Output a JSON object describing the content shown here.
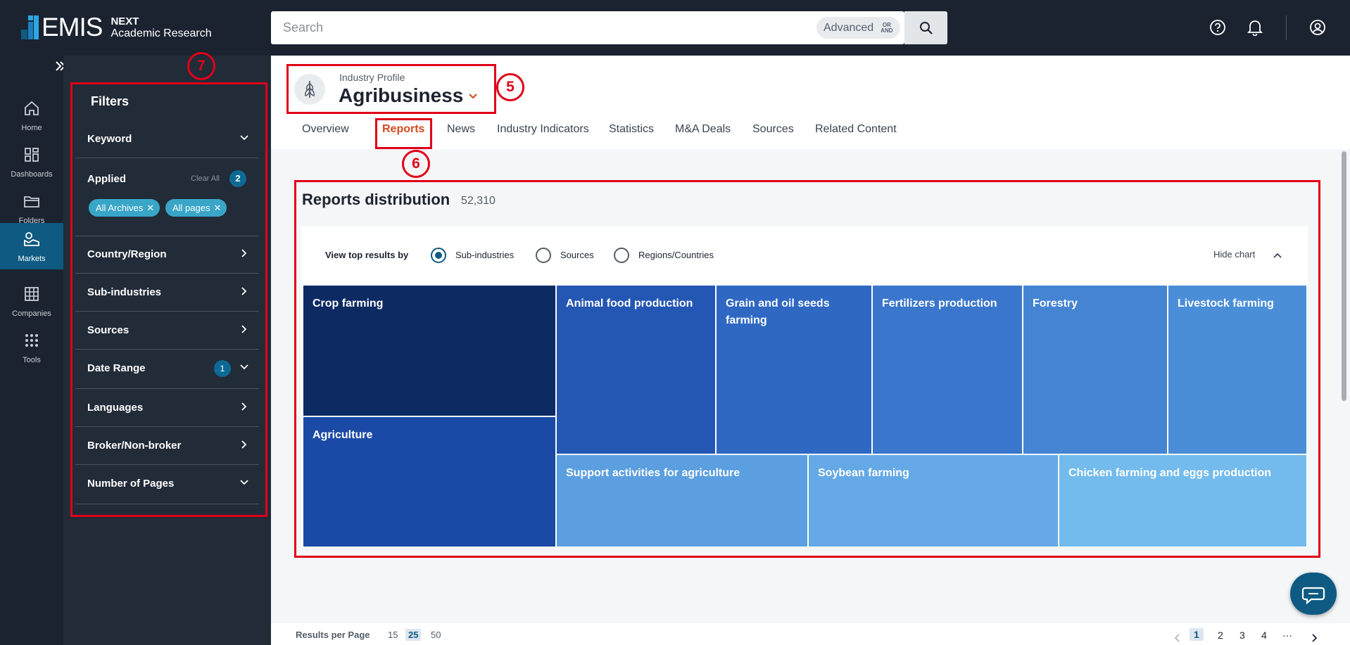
{
  "header": {
    "logo_word": "EMIS",
    "logo_line1": "NEXT",
    "logo_line2": "Academic Research",
    "search_placeholder": "Search",
    "advanced_label": "Advanced",
    "advanced_or": "OR",
    "advanced_and": "AND"
  },
  "leftnav": {
    "items": [
      {
        "label": "Home",
        "icon": "home-icon"
      },
      {
        "label": "Dashboards",
        "icon": "dashboard-icon"
      },
      {
        "label": "Folders",
        "icon": "folder-icon"
      },
      {
        "label": "Markets",
        "icon": "markets-icon"
      },
      {
        "label": "Companies",
        "icon": "companies-icon"
      },
      {
        "label": "Tools",
        "icon": "tools-icon"
      }
    ],
    "active": "Markets"
  },
  "filters": {
    "title": "Filters",
    "keyword": "Keyword",
    "applied_label": "Applied",
    "clear_all": "Clear All",
    "applied_count": "2",
    "chips": [
      "All Archives",
      "All pages"
    ],
    "rows": [
      {
        "label": "Country/Region"
      },
      {
        "label": "Sub-industries"
      },
      {
        "label": "Sources"
      },
      {
        "label": "Date Range",
        "count": "1"
      },
      {
        "label": "Languages"
      },
      {
        "label": "Broker/Non-broker"
      },
      {
        "label": "Number of Pages"
      }
    ]
  },
  "profile": {
    "small_label": "Industry Profile",
    "name": "Agribusiness"
  },
  "tabs": [
    "Overview",
    "Reports",
    "News",
    "Industry Indicators",
    "Statistics",
    "M&A Deals",
    "Sources",
    "Related Content"
  ],
  "active_tab": "Reports",
  "annotations": [
    "7",
    "5",
    "6"
  ],
  "reports": {
    "title": "Reports distribution",
    "count": "52,310",
    "view_by_label": "View top results by",
    "options": [
      "Sub-industries",
      "Sources",
      "Regions/Countries"
    ],
    "selected_option": "Sub-industries",
    "hide_chart": "Hide chart"
  },
  "chart_data": {
    "type": "treemap",
    "tiles": [
      {
        "label": "Crop farming",
        "color": "#0d2a63"
      },
      {
        "label": "Agriculture",
        "color": "#1b4aa6"
      },
      {
        "label": "Animal food production",
        "color": "#2457b4"
      },
      {
        "label": "Grain and oil seeds farming",
        "color": "#2f68c3"
      },
      {
        "label": "Fertilizers production",
        "color": "#3a77cc"
      },
      {
        "label": "Forestry",
        "color": "#4484d2"
      },
      {
        "label": "Livestock farming",
        "color": "#4b8ed8"
      },
      {
        "label": "Support activities for agriculture",
        "color": "#5b9fe0"
      },
      {
        "label": "Soybean farming",
        "color": "#64a9e5"
      },
      {
        "label": "Chicken farming and eggs production",
        "color": "#73bbec"
      }
    ]
  },
  "footer": {
    "results_per_page_label": "Results per Page",
    "per_page_options": [
      "15",
      "25",
      "50"
    ],
    "selected_per_page": "25",
    "pages": [
      "1",
      "2",
      "3",
      "4"
    ],
    "ellipsis": "···",
    "current_page": "1"
  }
}
